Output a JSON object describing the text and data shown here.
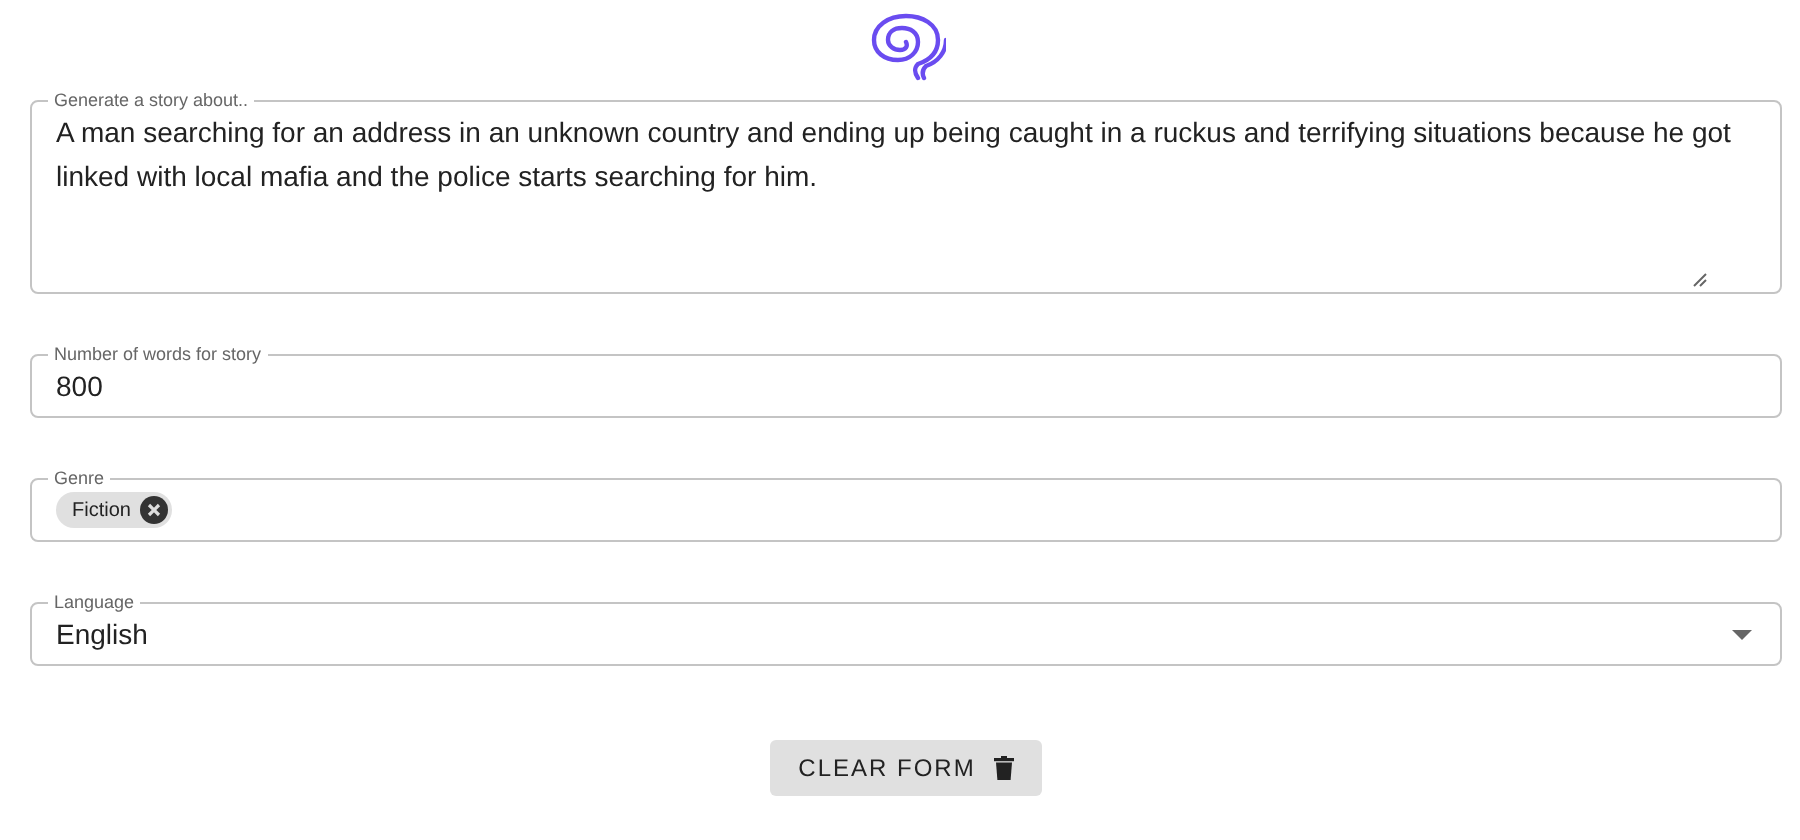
{
  "story_prompt": {
    "label": "Generate a story about..",
    "value": "A man searching for an address in an unknown country and ending up being caught in a ruckus and terrifying situations because he got linked with local mafia and the police starts searching for him."
  },
  "word_count": {
    "label": "Number of words for story",
    "value": "800"
  },
  "genre": {
    "label": "Genre",
    "chips": [
      "Fiction"
    ]
  },
  "language": {
    "label": "Language",
    "value": "English"
  },
  "buttons": [
    "CLEAR FORM"
  ]
}
